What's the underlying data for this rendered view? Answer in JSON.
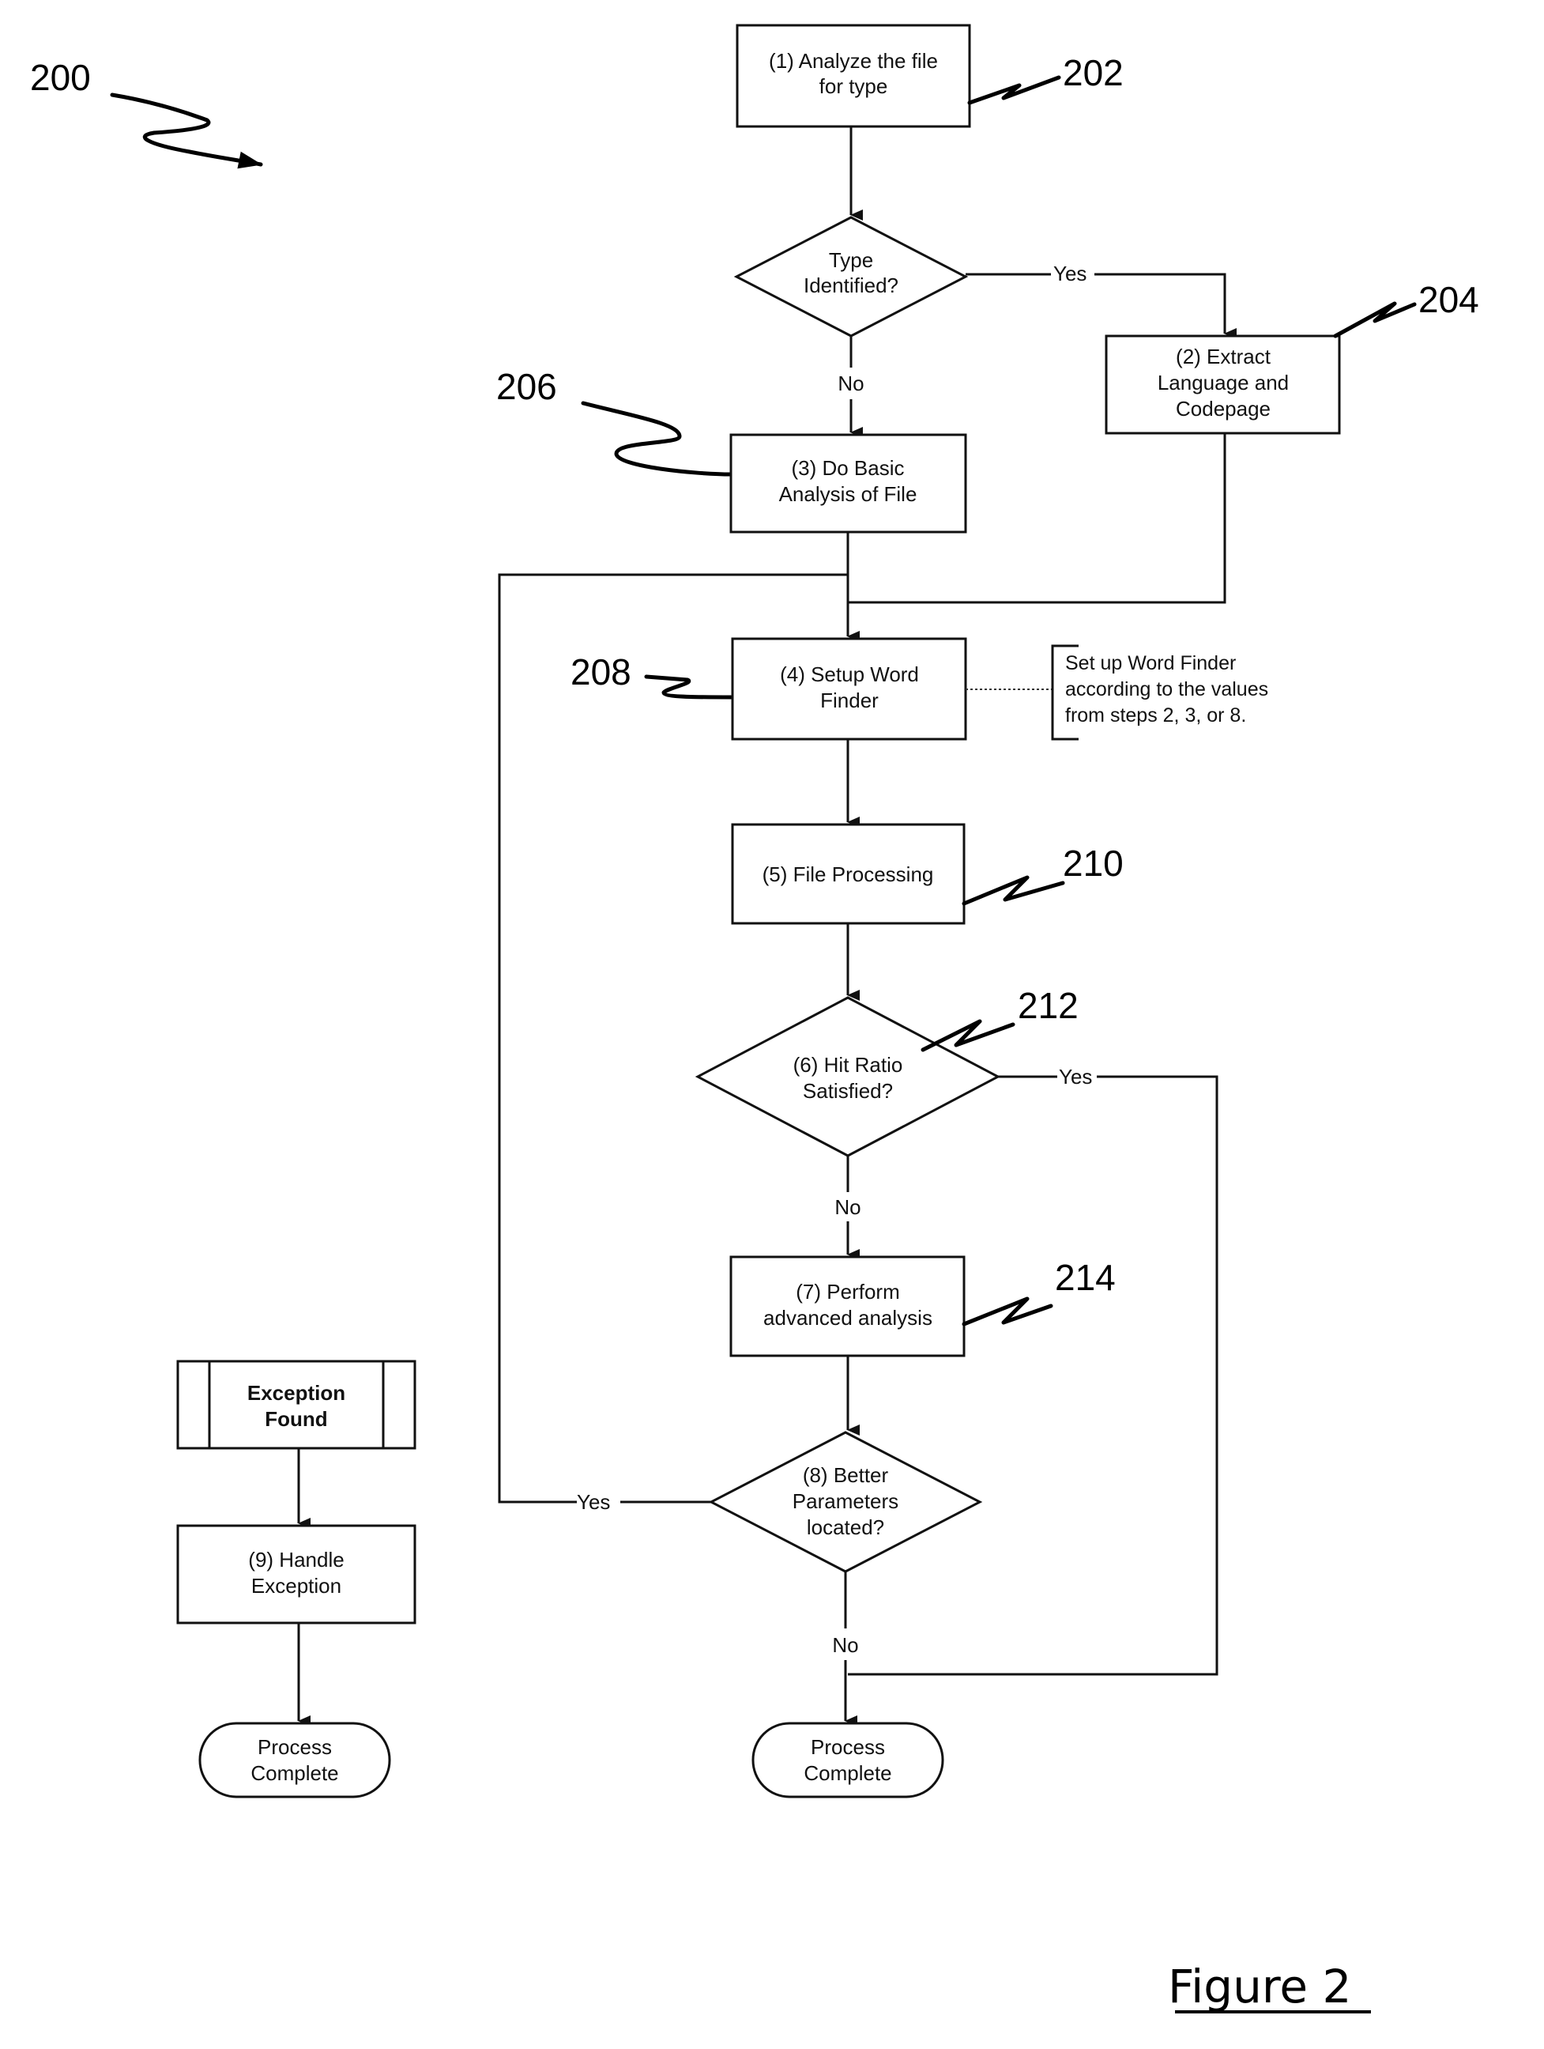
{
  "figure": {
    "caption": "Figure 2",
    "reference": "200"
  },
  "nodes": {
    "step1": {
      "ref": "202",
      "lines": [
        "(1) Analyze the file",
        "for type"
      ]
    },
    "decision_type": {
      "lines": [
        "Type",
        "Identified?"
      ]
    },
    "step2": {
      "ref": "204",
      "lines": [
        "(2) Extract",
        "Language and",
        "Codepage"
      ]
    },
    "step3": {
      "ref": "206",
      "lines": [
        "(3) Do Basic",
        "Analysis of File"
      ]
    },
    "step4": {
      "ref": "208",
      "lines": [
        "(4) Setup Word",
        "Finder"
      ]
    },
    "step4_note": {
      "lines": [
        "Set up Word Finder",
        "according to the values",
        "from steps 2, 3, or 8."
      ]
    },
    "step5": {
      "ref": "210",
      "lines": [
        "(5) File Processing"
      ]
    },
    "step6": {
      "ref": "212",
      "lines": [
        "(6) Hit Ratio",
        "Satisfied?"
      ]
    },
    "step7": {
      "ref": "214",
      "lines": [
        "(7) Perform",
        "advanced analysis"
      ]
    },
    "step8": {
      "lines": [
        "(8) Better",
        "Parameters",
        "located?"
      ]
    },
    "end_main": {
      "lines": [
        "Process",
        "Complete"
      ]
    },
    "exception": {
      "lines": [
        "Exception",
        "Found"
      ]
    },
    "step9": {
      "lines": [
        "(9) Handle",
        "Exception"
      ]
    },
    "end_exception": {
      "lines": [
        "Process",
        "Complete"
      ]
    }
  },
  "edges": {
    "type_yes": "Yes",
    "type_no": "No",
    "hit_yes": "Yes",
    "hit_no": "No",
    "better_yes": "Yes",
    "better_no": "No"
  }
}
